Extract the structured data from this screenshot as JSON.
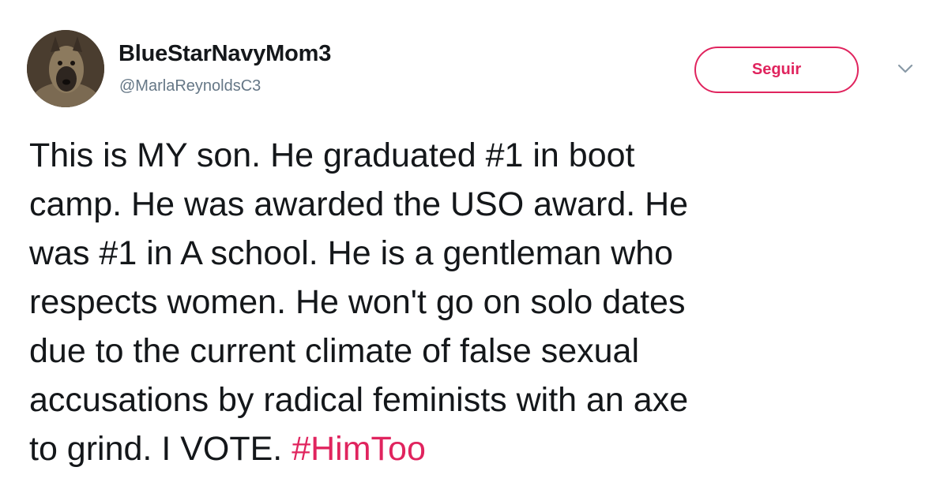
{
  "tweet": {
    "user": {
      "display_name": "BlueStarNavyMom3",
      "handle": "@MarlaReynoldsC3",
      "avatar_icon": "dog-photo-avatar"
    },
    "follow_button_label": "Seguir",
    "menu_icon": "chevron-down-icon",
    "text_lines": [
      "This is MY son. He graduated #1 in boot",
      "camp. He was awarded the USO award. He",
      "was #1 in A school. He is a gentleman who",
      "respects women. He won't go on solo dates",
      "due to the current climate of false sexual",
      "accusations by radical feminists with an axe",
      "to grind. I VOTE."
    ],
    "hashtag": "#HimToo",
    "colors": {
      "accent": "#e0245e",
      "text": "#14171a",
      "secondary": "#657786"
    }
  }
}
